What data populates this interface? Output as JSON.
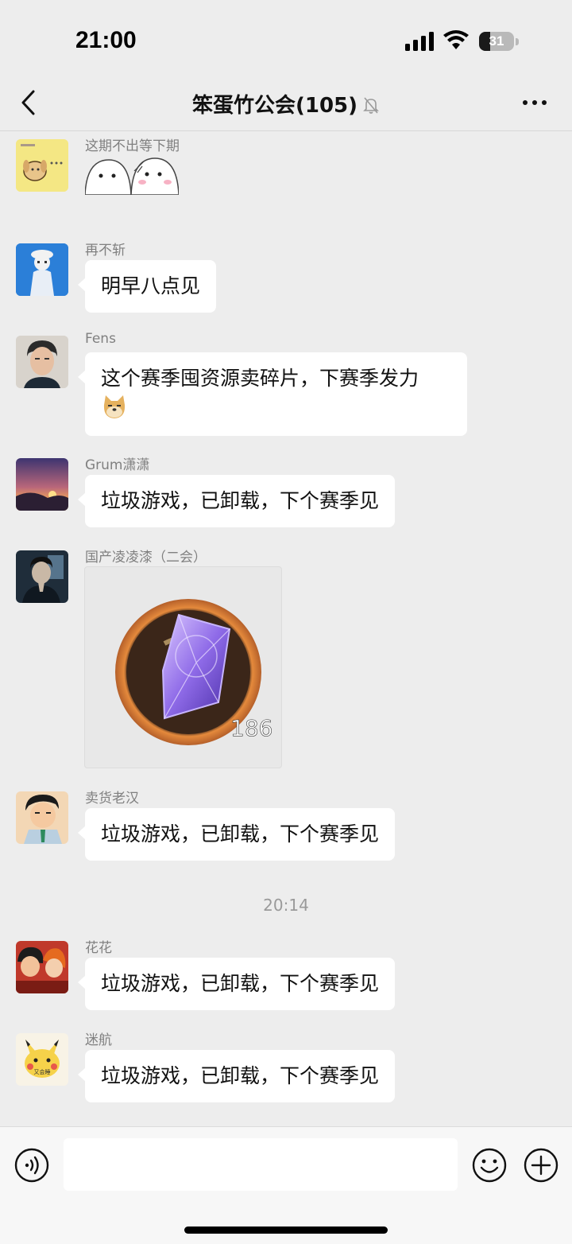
{
  "status_bar": {
    "time": "21:00",
    "battery": "31",
    "battery_level": 0.31
  },
  "header": {
    "title": "笨蛋竹公会(105)",
    "muted": true
  },
  "messages": [
    {
      "sender": "这期不出等下期",
      "type": "sticker"
    },
    {
      "sender": "再不斩",
      "text": "明早八点见"
    },
    {
      "sender": "Fens",
      "text": "这个赛季囤资源卖碎片，下赛季发力"
    },
    {
      "sender": "Grum潇潇",
      "text": "垃圾游戏，已卸载，下个赛季见"
    },
    {
      "sender": "国产凌凌漆（二会）",
      "type": "image",
      "image_caption": "186"
    },
    {
      "sender": "卖货老汉",
      "text": "垃圾游戏，已卸载，下个赛季见"
    },
    {
      "sender": "花花",
      "text": "垃圾游戏，已卸载，下个赛季见"
    },
    {
      "sender": "迷航",
      "text": "垃圾游戏，已卸载，下个赛季见"
    }
  ],
  "avatar_texts": {
    "pikachu_badge": "又会睡"
  },
  "timestamp": "20:14",
  "input": {
    "value": "",
    "placeholder": ""
  },
  "icons": [
    "back-icon",
    "mute-bell-icon",
    "more-icon",
    "voice-icon",
    "emoji-icon",
    "plus-icon"
  ]
}
